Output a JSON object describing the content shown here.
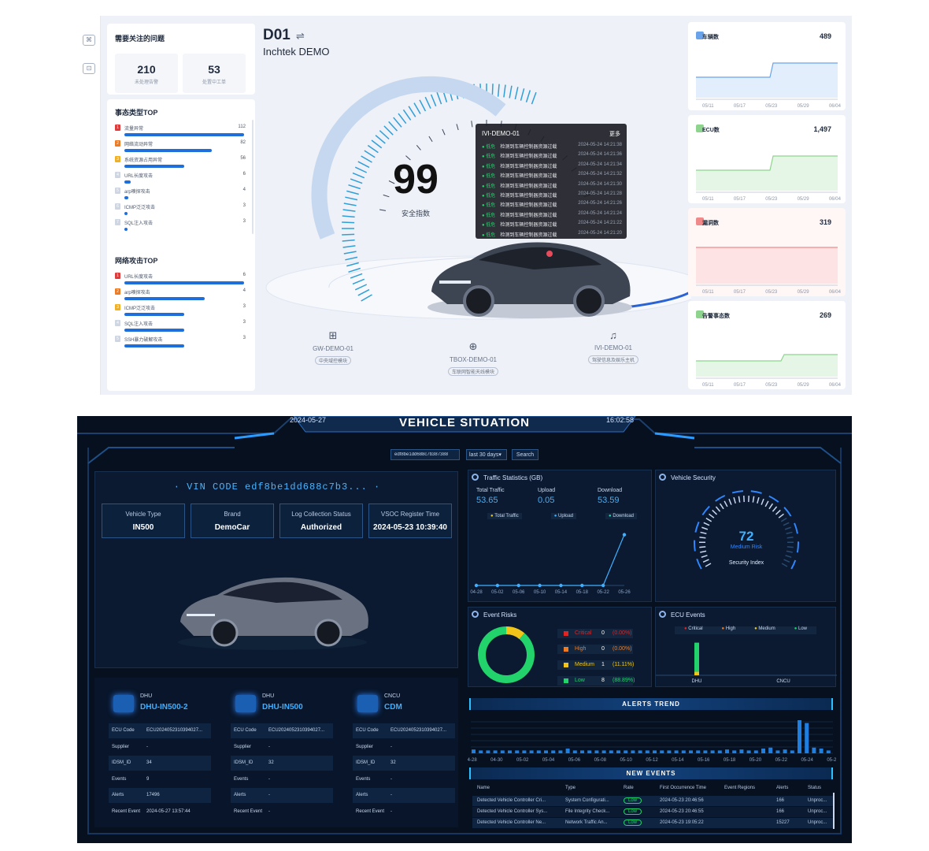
{
  "top": {
    "issues": {
      "title": "需要关注的问题",
      "stat1_value": "210",
      "stat1_label": "未处理告警",
      "stat2_value": "53",
      "stat2_label": "处置中工单"
    },
    "event_top": {
      "title": "事态类型TOP",
      "items": [
        {
          "name": "流量异常",
          "count": "112",
          "badge_color": "#e03c3c",
          "fill": 1.0
        },
        {
          "name": "网络流动异常",
          "count": "82",
          "badge_color": "#f07a22",
          "fill": 0.73
        },
        {
          "name": "系统资源占用异常",
          "count": "56",
          "badge_color": "#f0b022",
          "fill": 0.5
        },
        {
          "name": "URL长度攻击",
          "count": "6",
          "badge_color": "#cfd6e2",
          "fill": 0.05
        },
        {
          "name": "arp嗅探攻击",
          "count": "4",
          "badge_color": "#cfd6e2",
          "fill": 0.035
        },
        {
          "name": "ICMP泛泛攻击",
          "count": "3",
          "badge_color": "#cfd6e2",
          "fill": 0.027
        },
        {
          "name": "SQL注入攻击",
          "count": "3",
          "badge_color": "#cfd6e2",
          "fill": 0.027
        }
      ]
    },
    "attack_top": {
      "title": "网络攻击TOP",
      "items": [
        {
          "name": "URL长度攻击",
          "count": "6",
          "badge_color": "#e03c3c",
          "fill": 1.0
        },
        {
          "name": "arp嗅探攻击",
          "count": "4",
          "badge_color": "#f07a22",
          "fill": 0.67
        },
        {
          "name": "ICMP泛泛攻击",
          "count": "3",
          "badge_color": "#f0b022",
          "fill": 0.5
        },
        {
          "name": "SQL注入攻击",
          "count": "3",
          "badge_color": "#cfd6e2",
          "fill": 0.5
        },
        {
          "name": "SSH暴力破解攻击",
          "count": "3",
          "badge_color": "#cfd6e2",
          "fill": 0.5
        }
      ]
    },
    "vehicle": {
      "id": "D01",
      "swap_icon": "⇌",
      "name": "Inchtek DEMO",
      "score": "99",
      "score_label": "安全指数"
    },
    "tooltip": {
      "title": "IVI-DEMO-01",
      "more": "更多",
      "rows": [
        {
          "level": "低危",
          "text": "检测到车辆控制器资源过载",
          "time": "2024-05-24 14:21:38"
        },
        {
          "level": "低危",
          "text": "检测到车辆控制器资源过载",
          "time": "2024-05-24 14:21:36"
        },
        {
          "level": "低危",
          "text": "检测到车辆控制器资源过载",
          "time": "2024-05-24 14:21:34"
        },
        {
          "level": "低危",
          "text": "检测到车辆控制器资源过载",
          "time": "2024-05-24 14:21:32"
        },
        {
          "level": "低危",
          "text": "检测到车辆控制器资源过载",
          "time": "2024-05-24 14:21:30"
        },
        {
          "level": "低危",
          "text": "检测到车辆控制器资源过载",
          "time": "2024-05-24 14:21:28"
        },
        {
          "level": "低危",
          "text": "检测到车辆控制器资源过载",
          "time": "2024-05-24 14:21:26"
        },
        {
          "level": "低危",
          "text": "检测到车辆控制器资源过载",
          "time": "2024-05-24 14:21:24"
        },
        {
          "level": "低危",
          "text": "检测到车辆控制器资源过载",
          "time": "2024-05-24 14:21:22"
        },
        {
          "level": "低危",
          "text": "检测到车辆控制器资源过载",
          "time": "2024-05-24 14:21:20"
        }
      ]
    },
    "modules": [
      {
        "name": "GW-DEMO-01",
        "tag": "中央域控模块",
        "icon": "gateway-icon",
        "glyph": "⊞"
      },
      {
        "name": "TBOX-DEMO-01",
        "tag": "车联网智能天线模块",
        "icon": "globe-icon",
        "glyph": "⊕"
      },
      {
        "name": "IVI-DEMO-01",
        "tag": "驾驶信息及娱乐主机",
        "icon": "music-icon",
        "glyph": "♫"
      }
    ],
    "right_cards": [
      {
        "title": "车辆数",
        "value": "489",
        "icon": "bar-chart-icon",
        "line": "#6aa3ea",
        "fill": "#e3eefc",
        "bg": "#ffffff"
      },
      {
        "title": "ECU数",
        "value": "1,497",
        "icon": "list-icon",
        "line": "#8ed48e",
        "fill": "#e6f6e6",
        "bg": "#ffffff"
      },
      {
        "title": "漏洞数",
        "value": "319",
        "icon": "bug-icon",
        "line": "#f08a8a",
        "fill": "#fde3e3",
        "bg": "#fff6f6"
      },
      {
        "title": "告警事态数",
        "value": "269",
        "icon": "shield-check-icon",
        "line": "#8ed48e",
        "fill": "#e6f6e6",
        "bg": "#ffffff"
      }
    ],
    "date_ticks": [
      "05/11",
      "05/17",
      "05/23",
      "05/29",
      "06/04"
    ]
  },
  "bottom": {
    "date": "2024-05-27",
    "title": "VEHICLE SITUATION",
    "time": "16:02:58",
    "search": {
      "vin_value": "edf8be1dd688c7b387388",
      "range": "last 30 days",
      "button": "Search"
    },
    "vin_label": "· VIN CODE edf8be1dd688c7b3... ·",
    "info": [
      {
        "key": "Vehicle Type",
        "value": "IN500"
      },
      {
        "key": "Brand",
        "value": "DemoCar"
      },
      {
        "key": "Log Collection Status",
        "value": "Authorized"
      },
      {
        "key": "VSOC Register Time",
        "value": "2024-05-23 10:39:40"
      }
    ],
    "ecus": [
      {
        "tag": "DHU",
        "name": "DHU-IN500-2",
        "ecu_code": "ECU20240523103940​27...",
        "supplier": "-",
        "idsm_id": "34",
        "events": "9",
        "alerts": "17496",
        "recent": "2024-05-27 13:57:44"
      },
      {
        "tag": "DHU",
        "name": "DHU-IN500",
        "ecu_code": "ECU20240523103940​27...",
        "supplier": "-",
        "idsm_id": "32",
        "events": "-",
        "alerts": "-",
        "recent": "-"
      },
      {
        "tag": "CNCU",
        "name": "CDM",
        "ecu_code": "ECU20240523103940​27...",
        "supplier": "-",
        "idsm_id": "32",
        "events": "-",
        "alerts": "-",
        "recent": "-"
      }
    ],
    "ecu_keys": {
      "ecu_code": "ECU Code",
      "supplier": "Supplier",
      "idsm_id": "IDSM_ID",
      "events": "Events",
      "alerts": "Alerts",
      "recent": "Recent Event"
    },
    "traffic": {
      "title": "Traffic Statistics (GB)",
      "total_label": "Total Traffic",
      "total": "53.65",
      "upload_label": "Upload",
      "upload": "0.05",
      "download_label": "Download",
      "download": "53.59",
      "legend": [
        "Total Traffic",
        "Upload",
        "Download"
      ]
    },
    "security": {
      "title": "Vehicle Security",
      "score": "72",
      "risk": "Medium Risk",
      "label": "Security Index",
      "fraction": 0.72
    },
    "event_risks": {
      "title": "Event Risks",
      "rows": [
        {
          "level": "Critical",
          "count": "0",
          "pct": "(0.00%)",
          "color": "#e02424"
        },
        {
          "level": "High",
          "count": "0",
          "pct": "(0.00%)",
          "color": "#f07a22"
        },
        {
          "level": "Medium",
          "count": "1",
          "pct": "(11.11%)",
          "color": "#f0c419"
        },
        {
          "level": "Low",
          "count": "8",
          "pct": "(88.89%)",
          "color": "#22d36b"
        }
      ]
    },
    "ecu_events": {
      "title": "ECU Events",
      "legend": [
        "Critical",
        "High",
        "Medium",
        "Low"
      ],
      "cats": [
        "DHU",
        "CNCU"
      ]
    },
    "alerts_trend": {
      "title": "ALERTS TREND"
    },
    "new_events": {
      "title": "NEW EVENTS",
      "headers": [
        "Name",
        "Type",
        "Rate",
        "First Occurrence Time",
        "Event Regions",
        "Alerts",
        "Status"
      ],
      "rows": [
        [
          "Detected Vehicle Controller Cri...",
          "System Configurati...",
          "Low",
          "2024-05-23 20:46:56",
          "",
          "166",
          "Unproc..."
        ],
        [
          "Detected Vehicle Controller Sys...",
          "File Integrity Check...",
          "Low",
          "2024-05-23 20:46:55",
          "",
          "166",
          "Unproc..."
        ],
        [
          "Detected Vehicle Controller Ne...",
          "Network Traffic An...",
          "Low",
          "2024-05-23 19:05:22",
          "",
          "15227",
          "Unproc..."
        ]
      ]
    }
  },
  "chart_data": [
    {
      "type": "line",
      "title": "Traffic Statistics (GB)",
      "x": [
        "04-28",
        "05-02",
        "05-06",
        "05-10",
        "05-14",
        "05-18",
        "05-22",
        "05-26"
      ],
      "series": [
        {
          "name": "Total Traffic",
          "values": [
            0,
            0,
            0,
            0,
            0,
            0,
            0,
            53.65
          ]
        }
      ]
    },
    {
      "type": "pie",
      "title": "Event Risks",
      "categories": [
        "Critical",
        "High",
        "Medium",
        "Low"
      ],
      "values": [
        0,
        0,
        1,
        8
      ]
    },
    {
      "type": "bar",
      "title": "ECU Events",
      "categories": [
        "DHU",
        "CNCU"
      ],
      "series": [
        {
          "name": "Medium",
          "values": [
            1,
            0
          ]
        },
        {
          "name": "Low",
          "values": [
            8,
            0
          ]
        }
      ]
    },
    {
      "type": "bar",
      "title": "ALERTS TREND",
      "categories": [
        "04-28",
        "04-30",
        "05-02",
        "05-04",
        "05-06",
        "05-08",
        "05-10",
        "05-12",
        "05-14",
        "05-16",
        "05-18",
        "05-20",
        "05-22",
        "05-24",
        "05-26"
      ],
      "values": [
        0.4,
        0.3,
        0.3,
        0.3,
        0.3,
        0.3,
        0.3,
        0.3,
        0.3,
        0.3,
        0.3,
        0.3,
        0.3,
        0.5,
        0.3,
        0.3,
        0.3,
        0.3,
        0.3,
        0.3,
        0.3,
        0.3,
        0.3,
        0.3,
        0.3,
        0.3,
        0.3,
        0.3,
        0.3,
        0.3,
        0.3,
        0.3,
        0.3,
        0.3,
        0.3,
        0.4,
        0.3,
        0.4,
        0.3,
        0.3,
        0.5,
        0.6,
        0.3,
        0.4,
        0.3,
        3.5,
        3.2,
        0.6,
        0.5,
        0.3
      ],
      "ylim": [
        0,
        4
      ]
    }
  ]
}
